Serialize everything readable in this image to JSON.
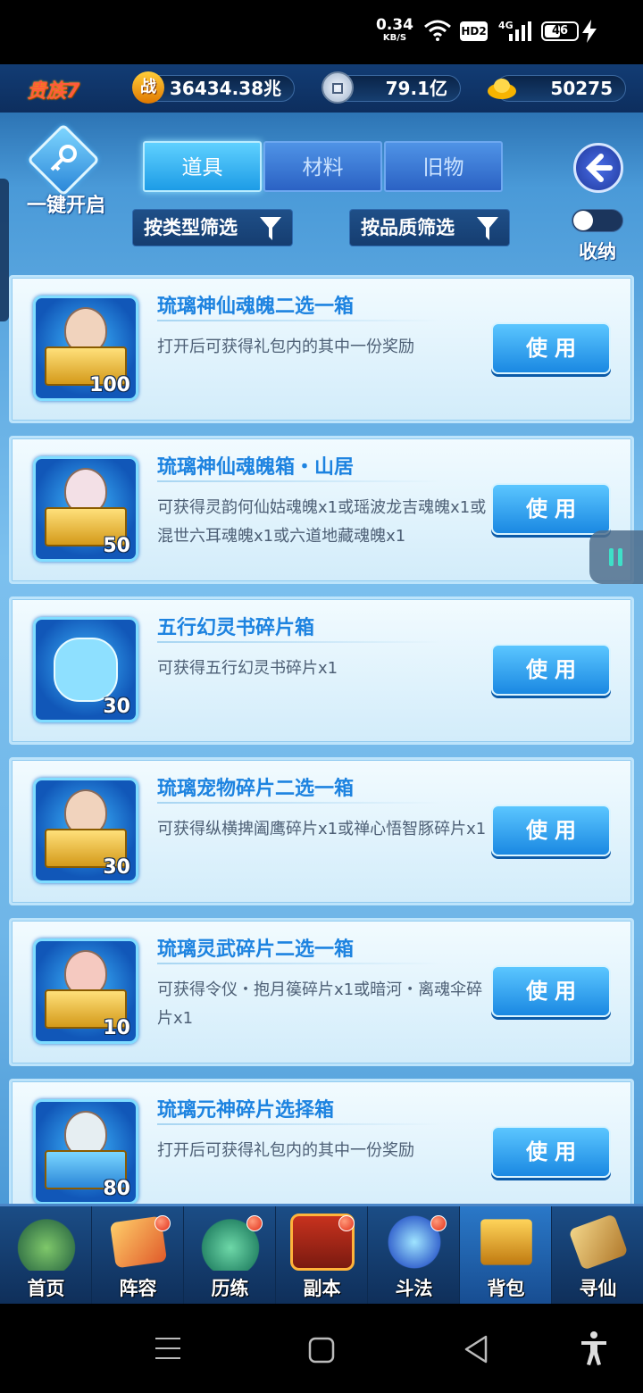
{
  "status_bar": {
    "speed_value": "0.34",
    "speed_unit": "KB/S",
    "hd_label": "HD2",
    "network": "4G",
    "battery": "46"
  },
  "header": {
    "rank": "贵族7",
    "power_icon": "战",
    "power": "36434.38兆",
    "silver": "79.1亿",
    "gold": "50275"
  },
  "actions": {
    "one_click_open": "一键开启",
    "filter_type": "按类型筛选",
    "filter_quality": "按品质筛选",
    "collapse": "收纳"
  },
  "tabs": [
    {
      "label": "道具",
      "active": true
    },
    {
      "label": "材料",
      "active": false
    },
    {
      "label": "旧物",
      "active": false
    }
  ],
  "use_label": "使用",
  "items": [
    {
      "name": "琉璃神仙魂魄二选一箱",
      "desc": "打开后可获得礼包内的其中一份奖励",
      "count": "100",
      "icon": "chest-hero-icon"
    },
    {
      "name": "琉璃神仙魂魄箱・山居",
      "desc": "可获得灵韵何仙姑魂魄x1或瑶波龙吉魂魄x1或混世六耳魂魄x1或六道地藏魂魄x1",
      "count": "50",
      "icon": "chest-hero-icon"
    },
    {
      "name": "五行幻灵书碎片箱",
      "desc": "可获得五行幻灵书碎片x1",
      "count": "30",
      "icon": "bag-icon"
    },
    {
      "name": "琉璃宠物碎片二选一箱",
      "desc": "可获得纵横捭阖鹰碎片x1或禅心悟智豚碎片x1",
      "count": "30",
      "icon": "chest-hero-icon"
    },
    {
      "name": "琉璃灵武碎片二选一箱",
      "desc": "可获得令仪・抱月篌碎片x1或暗河・离魂伞碎片x1",
      "count": "10",
      "icon": "chest-hero-icon"
    },
    {
      "name": "琉璃元神碎片选择箱",
      "desc": "打开后可获得礼包内的其中一份奖励",
      "count": "80",
      "icon": "chest-hero-icon"
    }
  ],
  "nav": [
    {
      "label": "首页",
      "badge": false,
      "active": false
    },
    {
      "label": "阵容",
      "badge": true,
      "active": false
    },
    {
      "label": "历练",
      "badge": true,
      "active": false
    },
    {
      "label": "副本",
      "badge": true,
      "active": false
    },
    {
      "label": "斗法",
      "badge": true,
      "active": false
    },
    {
      "label": "背包",
      "badge": false,
      "active": true
    },
    {
      "label": "寻仙",
      "badge": false,
      "active": false
    }
  ],
  "colors": {
    "accent": "#1d83e0",
    "button": "#1a88e2",
    "badge": "#e2301a",
    "nav_bg": "#0f2f5a"
  }
}
